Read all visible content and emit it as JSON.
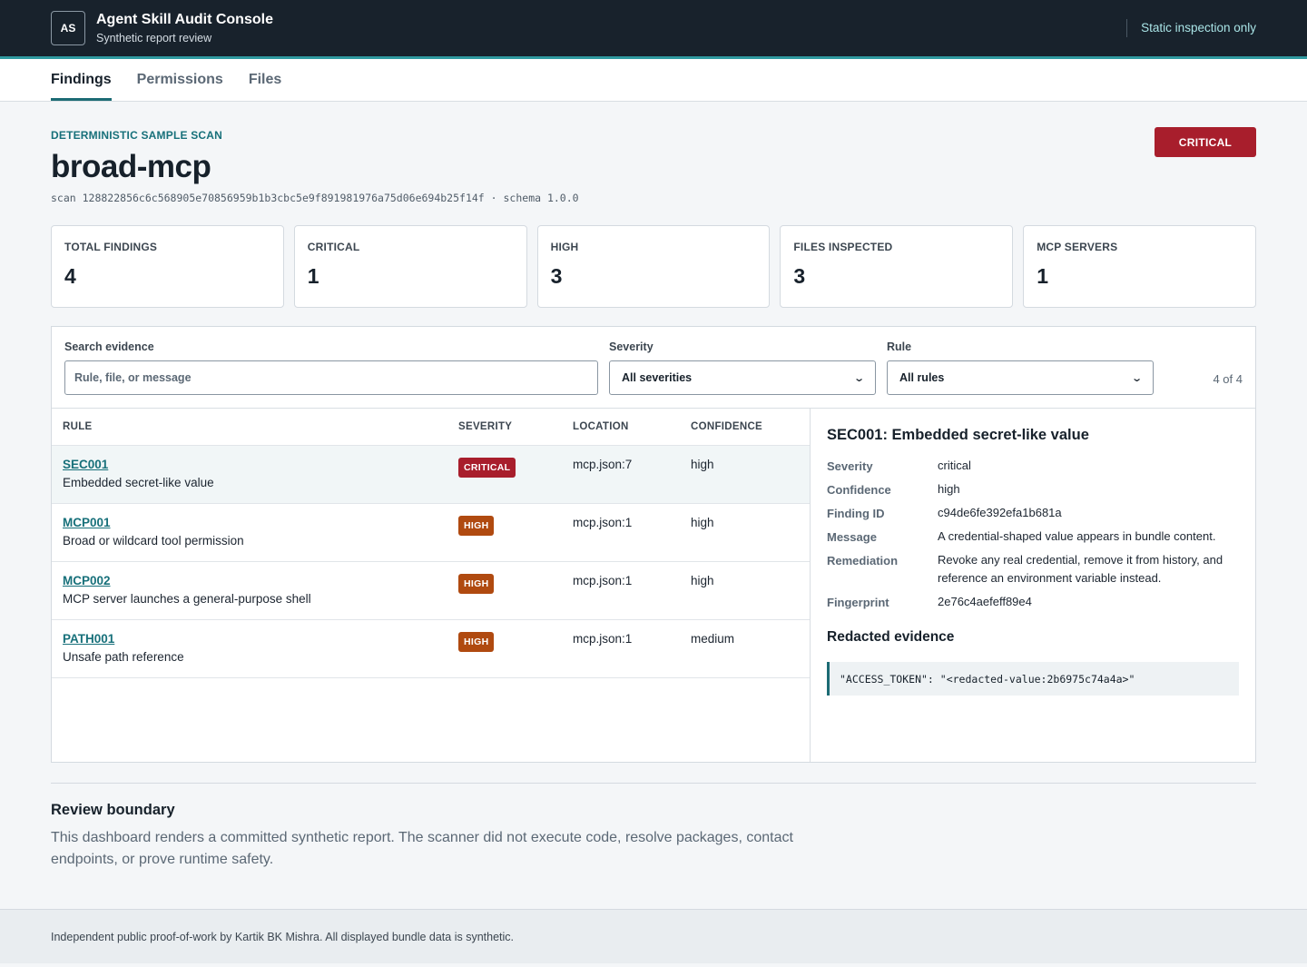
{
  "app": {
    "logo_initials": "AS",
    "title": "Agent Skill Audit Console",
    "subtitle": "Synthetic report review",
    "mode": "Static inspection only"
  },
  "tabs": [
    {
      "label": "Findings",
      "active": true
    },
    {
      "label": "Permissions",
      "active": false
    },
    {
      "label": "Files",
      "active": false
    }
  ],
  "hero": {
    "eyebrow": "DETERMINISTIC SAMPLE SCAN",
    "title": "broad-mcp",
    "meta": "scan 128822856c6c568905e70856959b1b3cbc5e9f891981976a75d06e694b25f14f · schema 1.0.0",
    "severity_badge": "CRITICAL"
  },
  "stats": [
    {
      "label": "TOTAL FINDINGS",
      "value": "4"
    },
    {
      "label": "CRITICAL",
      "value": "1"
    },
    {
      "label": "HIGH",
      "value": "3"
    },
    {
      "label": "FILES INSPECTED",
      "value": "3"
    },
    {
      "label": "MCP SERVERS",
      "value": "1"
    }
  ],
  "filters": {
    "search_label": "Search evidence",
    "search_placeholder": "Rule, file, or message",
    "severity_label": "Severity",
    "severity_value": "All severities",
    "rule_label": "Rule",
    "rule_value": "All rules",
    "count": "4 of 4"
  },
  "table": {
    "headers": [
      "RULE",
      "SEVERITY",
      "LOCATION",
      "CONFIDENCE"
    ],
    "rows": [
      {
        "rule": "SEC001",
        "message": "Embedded secret-like value",
        "severity": "CRITICAL",
        "location": "mcp.json:7",
        "confidence": "high"
      },
      {
        "rule": "MCP001",
        "message": "Broad or wildcard tool permission",
        "severity": "HIGH",
        "location": "mcp.json:1",
        "confidence": "high"
      },
      {
        "rule": "MCP002",
        "message": "MCP server launches a general-purpose shell",
        "severity": "HIGH",
        "location": "mcp.json:1",
        "confidence": "high"
      },
      {
        "rule": "PATH001",
        "message": "Unsafe path reference",
        "severity": "HIGH",
        "location": "mcp.json:1",
        "confidence": "medium"
      }
    ]
  },
  "detail": {
    "title": "SEC001: Embedded secret-like value",
    "fields": [
      {
        "label": "Severity",
        "value": "critical"
      },
      {
        "label": "Confidence",
        "value": "high"
      },
      {
        "label": "Finding ID",
        "value": "c94de6fe392efa1b681a"
      },
      {
        "label": "Message",
        "value": "A credential-shaped value appears in bundle content."
      },
      {
        "label": "Remediation",
        "value": "Revoke any real credential, remove it from history, and reference an environment variable instead."
      },
      {
        "label": "Fingerprint",
        "value": "2e76c4aefeff89e4"
      }
    ],
    "evidence_title": "Redacted evidence",
    "evidence": "\"ACCESS_TOKEN\": \"<redacted-value:2b6975c74a4a>\""
  },
  "boundary": {
    "title": "Review boundary",
    "text": "This dashboard renders a committed synthetic report. The scanner did not execute code, resolve packages, contact endpoints, or prove runtime safety."
  },
  "footer": {
    "text": "Independent public proof-of-work by Kartik BK Mishra. All displayed bundle data is synthetic."
  },
  "colors": {
    "critical": "#a81e2c",
    "high": "#b04a10",
    "accent": "#17707a",
    "topbar": "#18222c"
  }
}
